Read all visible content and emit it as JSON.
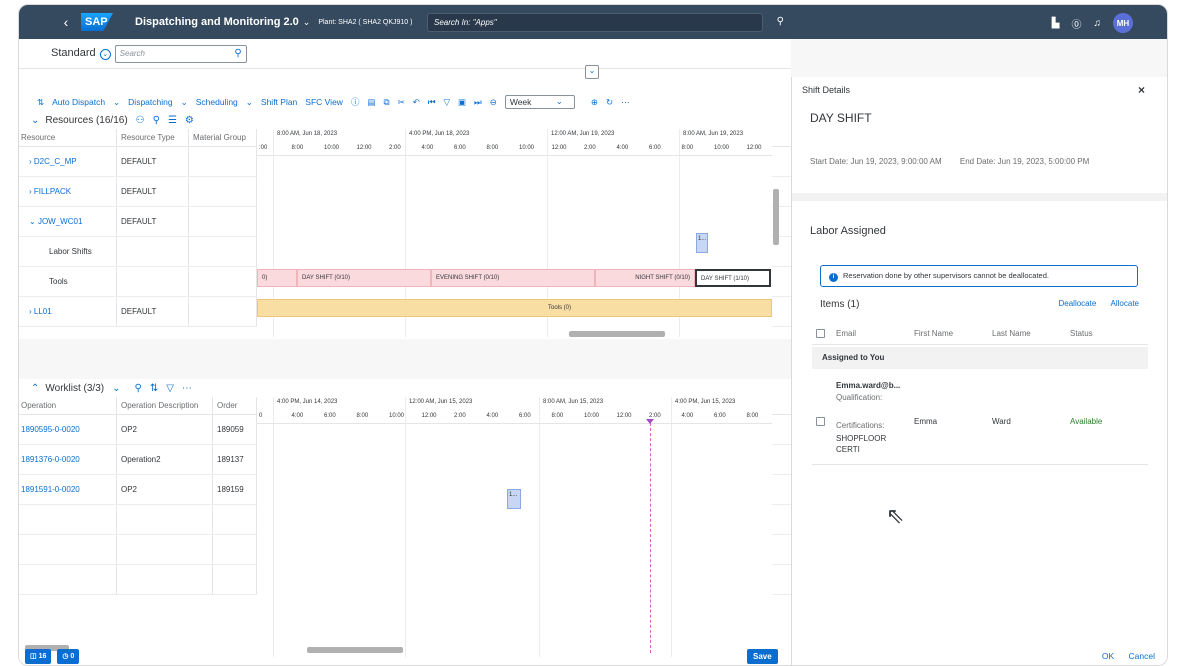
{
  "shell": {
    "app_title": "Dispatching and Monitoring 2.0",
    "plant": "Plant: SHA2 ( SHA2 QKJ910 )",
    "search_placeholder": "Search In: \"Apps\"",
    "avatar": "MH",
    "logo": "SAP"
  },
  "variant": {
    "name": "Standard",
    "search_placeholder": "Search"
  },
  "toolbar": {
    "auto_dispatch": "Auto Dispatch",
    "dispatching": "Dispatching",
    "scheduling": "Scheduling",
    "shift_plan": "Shift Plan",
    "sfc_view": "SFC View",
    "zoom": "Week"
  },
  "resources": {
    "title": "Resources (16/16)",
    "columns": [
      "Resource",
      "Resource Type",
      "Material Group"
    ],
    "rows": [
      {
        "name": "D2C_C_MP",
        "type": "DEFAULT"
      },
      {
        "name": "FILLPACK",
        "type": "DEFAULT"
      },
      {
        "name": "JOW_WC01",
        "type": "DEFAULT"
      },
      {
        "name": "Labor Shifts",
        "type": ""
      },
      {
        "name": "Tools",
        "type": ""
      },
      {
        "name": "LL01",
        "type": "DEFAULT"
      }
    ],
    "timeline_labels": [
      "8:00 AM, Jun 18, 2023",
      "4:00 PM, Jun 18, 2023",
      "12:00 AM, Jun 19, 2023",
      "8:00 AM, Jun 19, 2023"
    ],
    "ticks": [
      ":00",
      "8:00",
      "10:00",
      "12:00",
      "2:00",
      "4:00",
      "6:00",
      "8:00",
      "10:00",
      "12:00",
      "2:00",
      "4:00",
      "6:00",
      "8:00",
      "10:00",
      "12:00"
    ],
    "shifts": [
      "0)",
      "DAY SHIFT (0/10)",
      "EVENING SHIFT (0/10)",
      "NIGHT SHIFT (0/10)",
      "DAY SHIFT (1/10)"
    ],
    "tools_label": "Tools (0)",
    "op_marker": "1..."
  },
  "worklist": {
    "title": "Worklist (3/3)",
    "columns": [
      "Operation",
      "Operation Description",
      "Order"
    ],
    "rows": [
      {
        "op": "1890595-0-0020",
        "desc": "OP2",
        "order": "189059"
      },
      {
        "op": "1891376-0-0020",
        "desc": "Operation2",
        "order": "189137"
      },
      {
        "op": "1891591-0-0020",
        "desc": "OP2",
        "order": "189159"
      }
    ],
    "timeline_labels": [
      "4:00 PM, Jun 14, 2023",
      "12:00 AM, Jun 15, 2023",
      "8:00 AM, Jun 15, 2023",
      "4:00 PM, Jun 15, 2023"
    ],
    "ticks": [
      "0",
      "4:00",
      "6:00",
      "8:00",
      "10:00",
      "12:00",
      "2:00",
      "4:00",
      "6:00",
      "8:00",
      "10:00",
      "12:00",
      "2:00",
      "4:00",
      "6:00",
      "8:00"
    ],
    "op_marker": "1..."
  },
  "shift_details": {
    "title": "Shift Details",
    "shift_name": "DAY SHIFT",
    "start": "Start Date: Jun 19, 2023, 9:00:00 AM",
    "end": "End Date: Jun 19, 2023, 5:00:00 PM",
    "labor_title": "Labor Assigned",
    "info_message": "Reservation done by other supervisors cannot be deallocated.",
    "items_label": "Items (1)",
    "deallocate": "Deallocate",
    "allocate": "Allocate",
    "columns": [
      "Email",
      "First Name",
      "Last Name",
      "Status"
    ],
    "group": "Assigned to You",
    "item": {
      "email": "Emma.ward@b...",
      "qualification": "Qualification:",
      "certifications_label": "Certifications:",
      "certifications": "SHOPFLOOR CERTI",
      "first": "Emma",
      "last": "Ward",
      "status": "Available"
    }
  },
  "footer": {
    "badge1": "16",
    "badge2": "0",
    "save": "Save",
    "ok": "OK",
    "cancel": "Cancel"
  }
}
